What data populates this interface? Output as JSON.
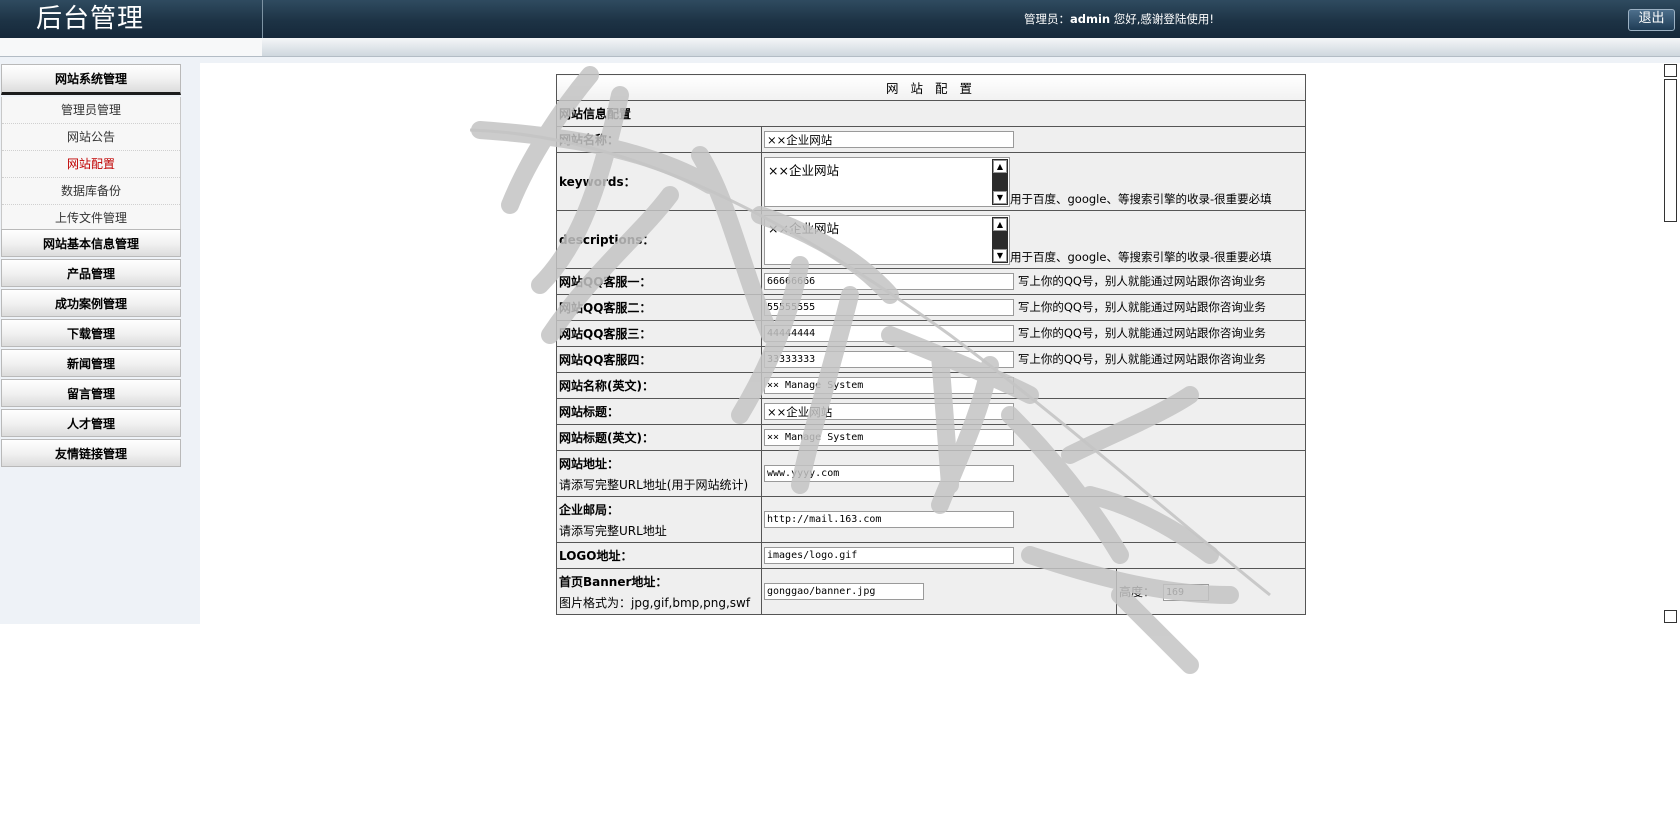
{
  "header": {
    "app_title": "后台管理",
    "welcome_prefix": "管理员：",
    "username": "admin",
    "welcome_suffix": " 您好,感谢登陆使用!",
    "logout_label": "退出"
  },
  "sidebar": {
    "sections": [
      {
        "label": "网站系统管理",
        "expanded": true,
        "items": [
          "管理员管理",
          "网站公告",
          "网站配置",
          "数据库备份",
          "上传文件管理"
        ],
        "active_item": "网站配置"
      },
      {
        "label": "网站基本信息管理"
      },
      {
        "label": "产品管理"
      },
      {
        "label": "成功案例管理"
      },
      {
        "label": "下载管理"
      },
      {
        "label": "新闻管理"
      },
      {
        "label": "留言管理"
      },
      {
        "label": "人才管理"
      },
      {
        "label": "友情链接管理"
      }
    ]
  },
  "form": {
    "title": "网 站 配 置",
    "section_header": "网站信息配置",
    "rows": {
      "site_name": {
        "label": "网站名称：",
        "value": "××企业网站"
      },
      "keywords": {
        "label": "keywords：",
        "value": "××企业网站",
        "hint": "用于百度、google、等搜索引擎的收录-很重要必填"
      },
      "descriptions": {
        "label": "descriptions：",
        "value": "××企业网站",
        "hint": "用于百度、google、等搜索引擎的收录-很重要必填"
      },
      "qq1": {
        "label": "网站QQ客服一：",
        "value": "66666666",
        "hint": "写上你的QQ号，别人就能通过网站跟你咨询业务"
      },
      "qq2": {
        "label": "网站QQ客服二：",
        "value": "55555555",
        "hint": "写上你的QQ号，别人就能通过网站跟你咨询业务"
      },
      "qq3": {
        "label": "网站QQ客服三：",
        "value": "44444444",
        "hint": "写上你的QQ号，别人就能通过网站跟你咨询业务"
      },
      "qq4": {
        "label": "网站QQ客服四：",
        "value": "33333333",
        "hint": "写上你的QQ号，别人就能通过网站跟你咨询业务"
      },
      "site_name_en": {
        "label": "网站名称(英文)：",
        "value": "×× Manage System"
      },
      "site_title": {
        "label": "网站标题：",
        "value": "××企业网站"
      },
      "site_title_en": {
        "label": "网站标题(英文)：",
        "value": "×× Manage System"
      },
      "site_url": {
        "label": "网站地址：",
        "sublabel": "请添写完整URL地址(用于网站统计)",
        "value": "www.yyyy.com"
      },
      "mail": {
        "label": "企业邮局：",
        "sublabel": "请添写完整URL地址",
        "value": "http://mail.163.com"
      },
      "logo": {
        "label": "LOGO地址：",
        "value": "images/logo.gif"
      },
      "banner": {
        "label": "首页Banner地址：",
        "sublabel": "图片格式为：jpg,gif,bmp,png,swf",
        "value": "gonggao/banner.jpg",
        "height_label": "高度：",
        "height_value": "169"
      }
    }
  },
  "colors": {
    "topbar": "#1d3345",
    "sidebar_bg": "#eef2f7",
    "active_item": "#c00000",
    "watermark": "#c8c8c8"
  }
}
